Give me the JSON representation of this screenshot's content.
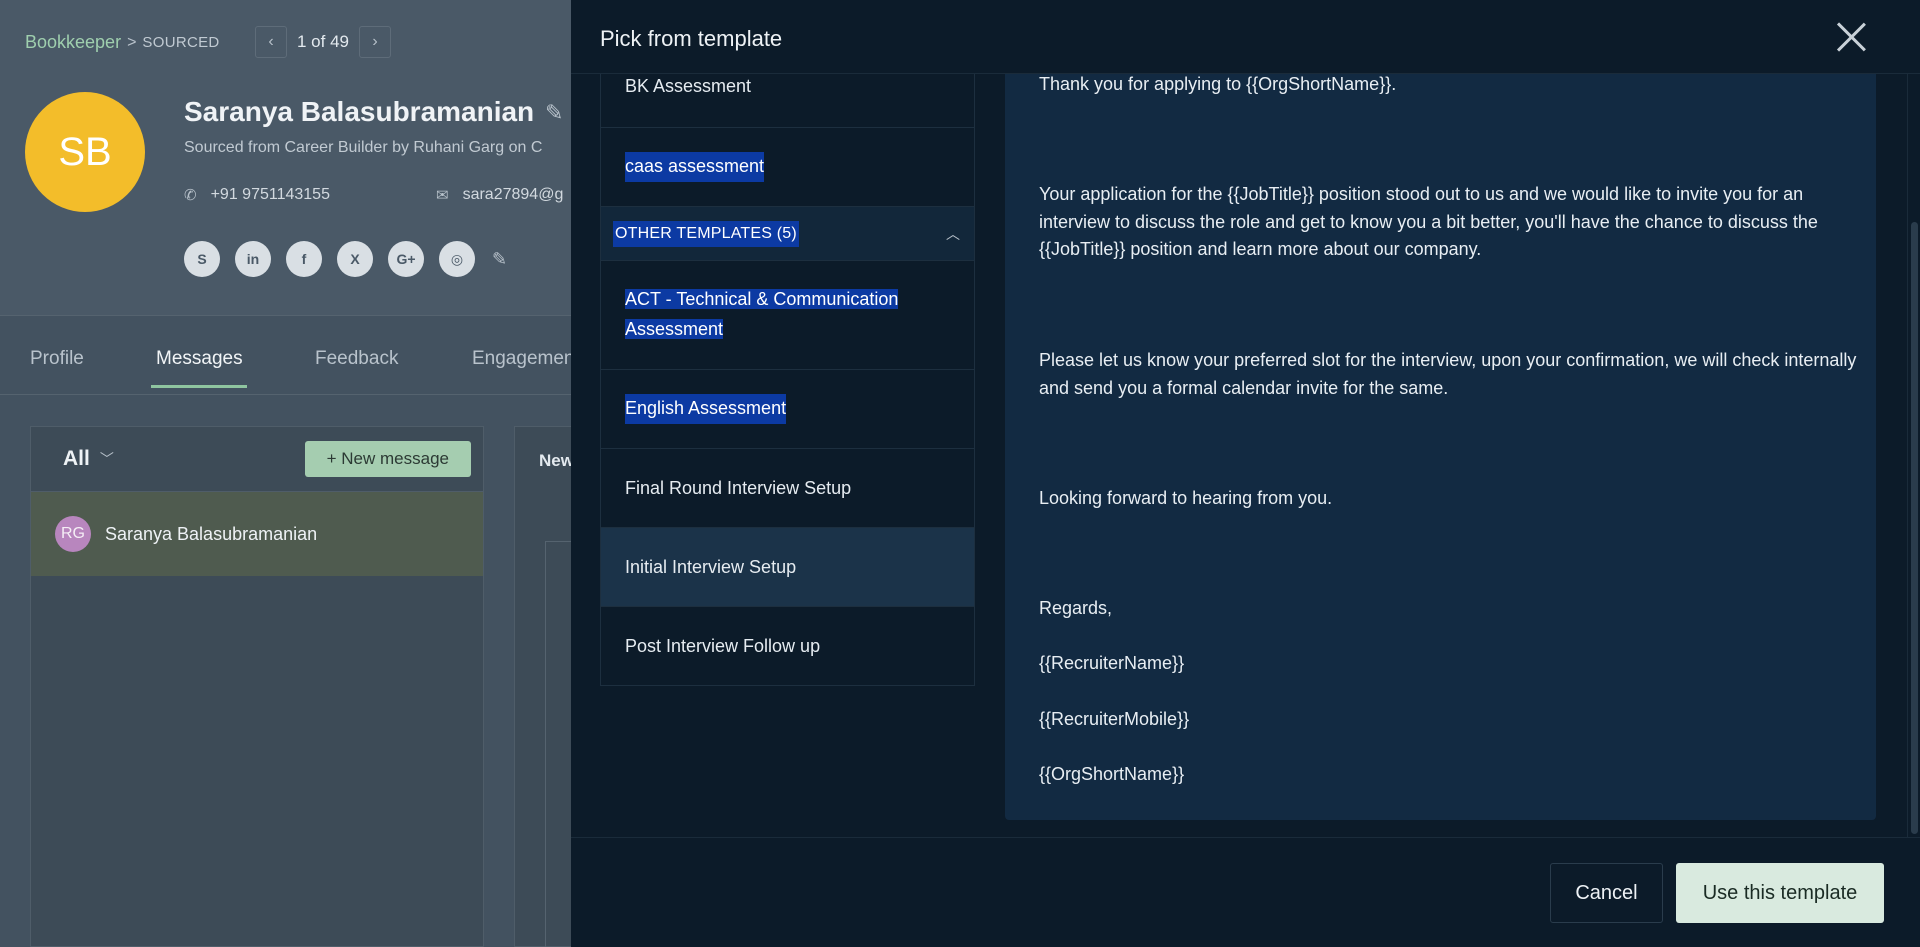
{
  "breadcrumb": {
    "job": "Bookkeeper",
    "separator": ">",
    "status": "SOURCED"
  },
  "pager": {
    "prev": "‹",
    "text": "1 of 49",
    "next": "›"
  },
  "candidate": {
    "initials": "SB",
    "name": "Saranya Balasubramanian",
    "sourced": "Sourced from Career Builder by Ruhani Garg on C",
    "phone": "+91 9751143155",
    "email": "sara27894@g",
    "avatar_color": "#f3bd2a"
  },
  "socials": [
    {
      "icon": "skype-icon",
      "glyph": "S"
    },
    {
      "icon": "linkedin-icon",
      "glyph": "in"
    },
    {
      "icon": "facebook-icon",
      "glyph": "f"
    },
    {
      "icon": "x-icon",
      "glyph": "X"
    },
    {
      "icon": "google-plus-icon",
      "glyph": "G+"
    },
    {
      "icon": "globe-icon",
      "glyph": "◎"
    }
  ],
  "tabs": [
    "Profile",
    "Messages",
    "Feedback",
    "Engagement"
  ],
  "messages": {
    "filter": "All",
    "new_message": "+ New message",
    "thread": {
      "initials": "RG",
      "name": "Saranya Balasubramanian"
    },
    "compose_tab": "New"
  },
  "drawer": {
    "title": "Pick from template",
    "templates": {
      "item_bk": "BK Assessment",
      "item_caas": "caas assessment",
      "group_label": "OTHER TEMPLATES (5)",
      "item_act": "ACT - Technical & Communication Assessment",
      "item_english": "English Assessment",
      "item_final": "Final Round Interview Setup",
      "item_initial": "Initial Interview Setup",
      "item_post": "Post Interview Follow up"
    },
    "preview": {
      "p1": "Thank you for applying to {{OrgShortName}}.",
      "p2": "Your application for the {{JobTitle}} position stood out to us and we would like to invite you for an interview to discuss the role and get to know you a bit better, you'll have the chance to discuss the {{JobTitle}} position and learn more about our company.",
      "p3": "Please let us know your preferred slot for the interview, upon your confirmation, we will check internally and send you a formal calendar invite for the same.",
      "p4": "Looking forward to hearing from you.",
      "p5": "Regards,",
      "p6": "{{RecruiterName}}",
      "p7": "{{RecruiterMobile}}",
      "p8": "{{OrgShortName}}"
    },
    "cancel": "Cancel",
    "use": "Use this template"
  }
}
